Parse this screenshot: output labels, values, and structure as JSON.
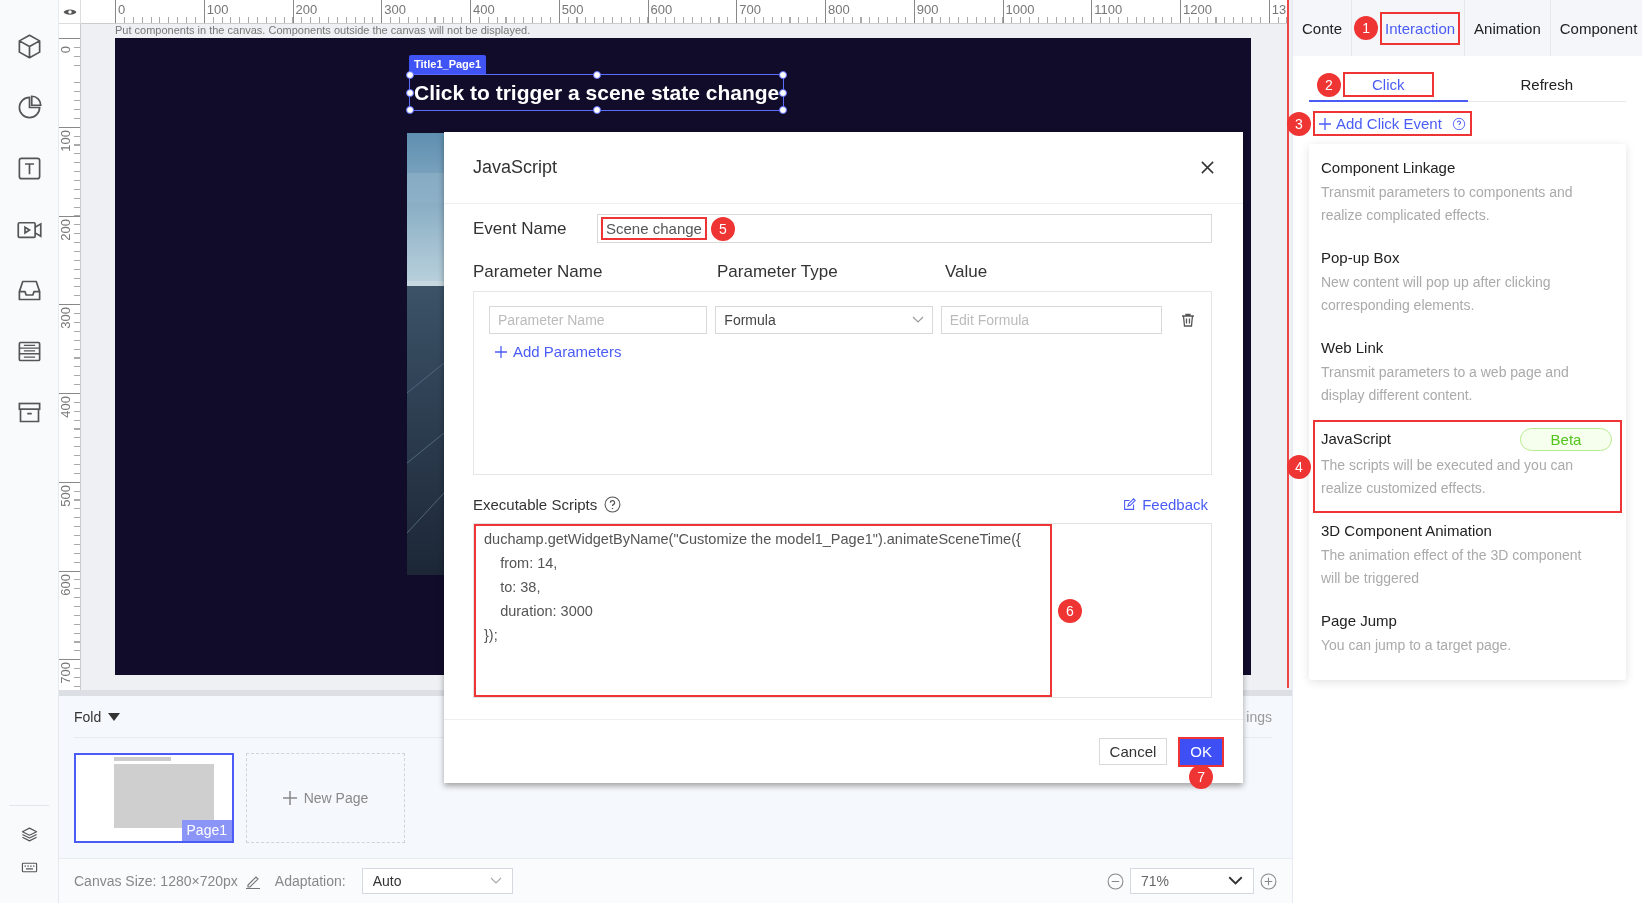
{
  "ruler": {
    "top_labels": [
      "0",
      "100",
      "200",
      "300",
      "400",
      "500",
      "600",
      "700",
      "800",
      "900",
      "1000",
      "1100",
      "1200",
      "13"
    ],
    "left_labels": [
      "0",
      "100",
      "200",
      "300",
      "400",
      "500",
      "600",
      "700"
    ]
  },
  "canvas": {
    "hint": "Put components in the canvas. Components outside the canvas will not be displayed.",
    "component_tag": "Title1_Page1",
    "component_text": "Click to trigger a scene state change"
  },
  "pages_panel": {
    "fold_label": "Fold",
    "settings_fragment": "ings",
    "pages": [
      {
        "name": "Page1",
        "selected": true
      }
    ],
    "new_page": "New Page"
  },
  "status_bar": {
    "canvas_size": "Canvas Size: 1280×720px",
    "adaptation_label": "Adaptation:",
    "adaptation_value": "Auto",
    "zoom": "71%"
  },
  "right_panel": {
    "tabs": [
      {
        "label": "Conte",
        "selected": false
      },
      {
        "label": "Interaction",
        "selected": true,
        "callout": "1"
      },
      {
        "label": "Animation",
        "selected": false
      },
      {
        "label": "Component",
        "selected": false
      }
    ],
    "subtabs": [
      {
        "label": "Click",
        "selected": true,
        "callout": "2"
      },
      {
        "label": "Refresh",
        "selected": false
      }
    ],
    "add_event": {
      "label": "Add Click Event",
      "callout": "3"
    },
    "event_types": [
      {
        "title": "Component Linkage",
        "description": "Transmit parameters to components and realize complicated effects."
      },
      {
        "title": "Pop-up Box",
        "description": "New content will pop up after clicking corresponding elements."
      },
      {
        "title": "Web Link",
        "description": "Transmit parameters to a web page and display different content."
      },
      {
        "title": "JavaScript",
        "description": "The scripts will be executed and you can realize customized effects.",
        "badge": "Beta",
        "callout": "4"
      },
      {
        "title": "3D Component Animation",
        "description": "The animation effect of the 3D component will be triggered"
      },
      {
        "title": "Page Jump",
        "description": "You can jump to a target page."
      }
    ]
  },
  "dialog": {
    "title": "JavaScript",
    "event_name_label": "Event Name",
    "event_name_value": "Scene change",
    "event_name_callout": "5",
    "columns": [
      "Parameter Name",
      "Parameter Type",
      "Value"
    ],
    "parameter_rows": [
      {
        "name_placeholder": "Parameter Name",
        "type": "Formula",
        "value_placeholder": "Edit Formula"
      }
    ],
    "add_parameters": "Add Parameters",
    "scripts_label": "Executable Scripts",
    "feedback": "Feedback",
    "script": "duchamp.getWidgetByName(\"Customize the model1_Page1\").animateSceneTime({\n    from: 14,\n    to: 38,\n    duration: 3000\n});",
    "script_callout": "6",
    "buttons": [
      {
        "label": "Cancel",
        "kind": "secondary"
      },
      {
        "label": "OK",
        "kind": "primary",
        "callout": "7"
      }
    ]
  }
}
